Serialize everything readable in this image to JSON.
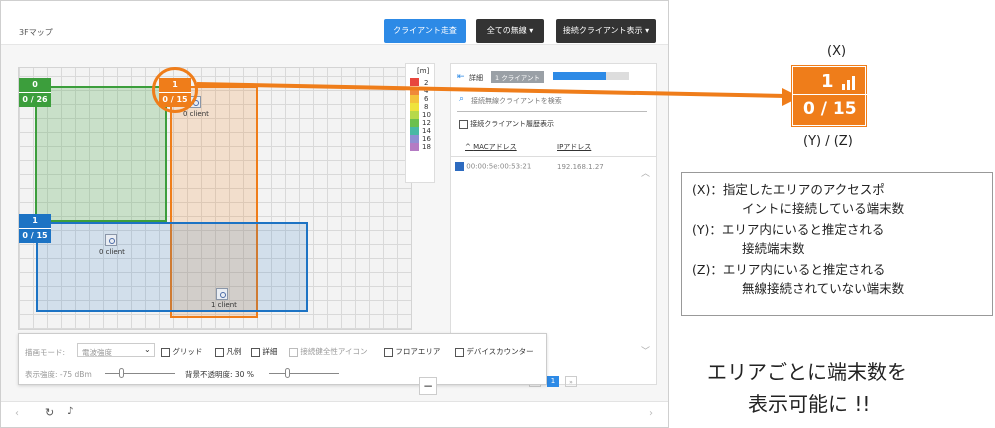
{
  "header": {
    "floor_title": "3Fマップ",
    "client_walk_btn": "クライアント走査",
    "all_wireless_btn": "全ての無線 ▾",
    "connected_client_btn": "接続クライアント表示 ▾"
  },
  "areas": [
    {
      "id": "green",
      "count": "0",
      "ratio": "0 / 26",
      "color": "#3c9e3c"
    },
    {
      "id": "orange",
      "count": "1",
      "ratio": "0 / 15",
      "color": "#ef7d1a"
    },
    {
      "id": "blue",
      "count": "1",
      "ratio": "0 / 15",
      "color": "#1c73c4"
    }
  ],
  "access_points": [
    {
      "label": "0 client"
    },
    {
      "label": "0 client"
    },
    {
      "label": "1 client"
    }
  ],
  "legend": {
    "unit": "[m]",
    "items": [
      {
        "value": "2",
        "color": "#e8473e"
      },
      {
        "value": "4",
        "color": "#f08a3a"
      },
      {
        "value": "6",
        "color": "#f4c33b"
      },
      {
        "value": "8",
        "color": "#efe33c"
      },
      {
        "value": "10",
        "color": "#b7d94a"
      },
      {
        "value": "12",
        "color": "#6cc04e"
      },
      {
        "value": "14",
        "color": "#49b9a4"
      },
      {
        "value": "16",
        "color": "#8f8fd2"
      },
      {
        "value": "18",
        "color": "#b47bc4"
      }
    ]
  },
  "panel": {
    "detail_label": "詳細",
    "client_count_badge": "1 クライアント",
    "progress": 0.7,
    "search_placeholder": "接続無線クライアントを検索",
    "history_label": "接続クライアント履歴表示",
    "col_mac": "MACアドレス",
    "col_ip": "IPアドレス",
    "rows": [
      {
        "mac": "00:00:5e:00:53:21",
        "ip": "192.168.1.27"
      }
    ],
    "page": "1"
  },
  "controls": {
    "draw_mode_label": "描画モード:",
    "draw_mode_value": "電波強度",
    "grid": "グリッド",
    "legend": "凡例",
    "detail": "詳細",
    "health_icon": "接続健全性アイコン",
    "floor_area": "フロアエリア",
    "device_counter": "デバイスカウンター",
    "strength_label": "表示強度: -75 dBm",
    "opacity_label": "背景不透明度: 30 %"
  },
  "callout": {
    "x_label": "(X)",
    "count": "1",
    "ratio": "0 / 15",
    "yz_label": "(Y) / (Z)",
    "badge_color": "#ef7d1a"
  },
  "description": {
    "line1": "(X)：指定したエリアのアクセスポ",
    "line1b": "イントに接続している端末数",
    "line2": "(Y)：エリア内にいると推定される",
    "line2b": "接続端末数",
    "line3": "(Z)：エリア内にいると推定される",
    "line3b": "無線接続されていない端末数"
  },
  "tagline": {
    "line1": "エリアごとに端末数を",
    "line2": "表示可能に !!"
  }
}
